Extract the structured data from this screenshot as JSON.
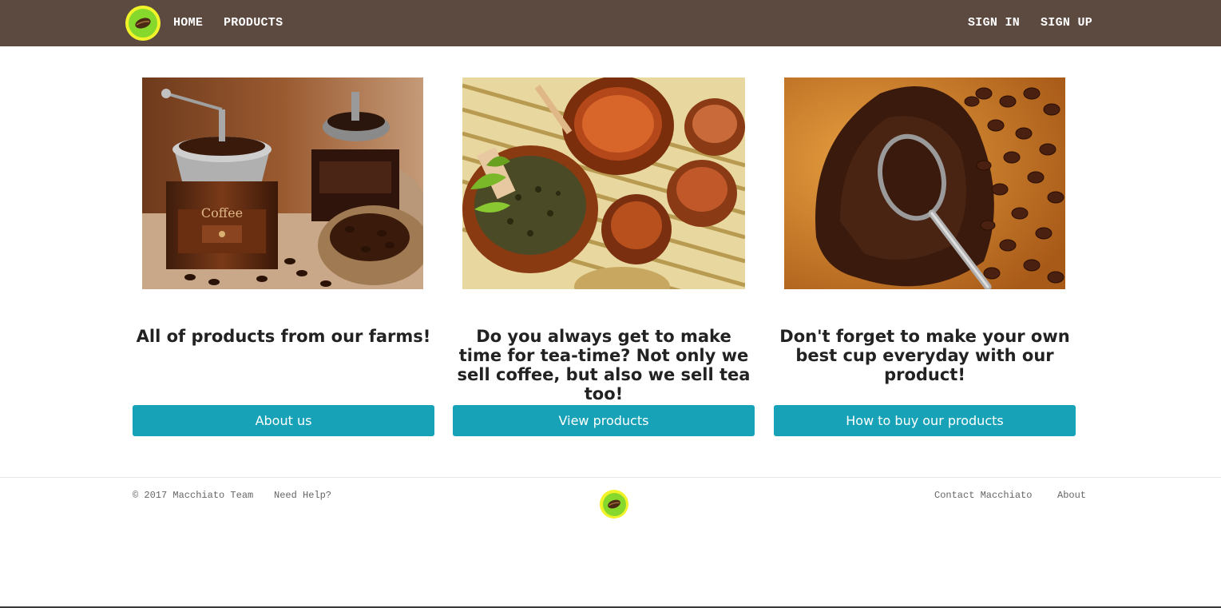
{
  "nav": {
    "logo_icon": "coffee-bean-icon",
    "home_label": "HOME",
    "products_label": "PRODUCTS",
    "sign_in_label": "SIGN IN",
    "sign_up_label": "SIGN UP",
    "background_color": "#5c4a40"
  },
  "cards": [
    {
      "heading": "All of products from our farms!",
      "button_label": "About us"
    },
    {
      "heading": "Do you always get to make time for tea-time? Not only we sell coffee, but also we sell tea too!",
      "button_label": "View products"
    },
    {
      "heading": "Don't forget to make your own best cup everyday with our product!",
      "button_label": "How to buy our products"
    }
  ],
  "accent_color": "#17a2b8",
  "footer": {
    "copyright": "© 2017 Macchiato Team",
    "help_label": "Need Help?",
    "logo_icon": "coffee-bean-icon",
    "contact_label": "Contact Macchiato",
    "about_label": "About"
  }
}
